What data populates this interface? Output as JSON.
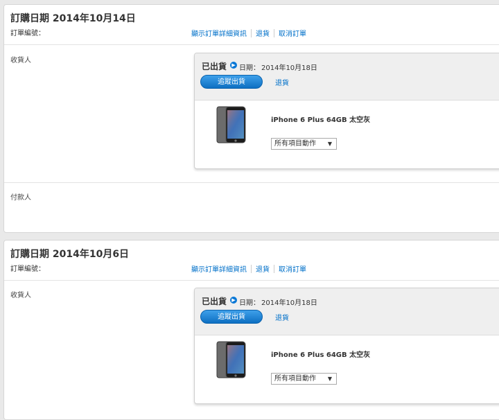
{
  "orders": [
    {
      "title": "訂購日期 2014年10月14日",
      "order_number_label": "訂單編號：",
      "links": {
        "details": "顯示訂單詳細資訊",
        "return": "退貨",
        "cancel": "取消訂單"
      },
      "recipient_label": "收貨人",
      "payer_label": "付款人",
      "shipment": {
        "status": "已出貨",
        "date_label": "日期：",
        "date_value": "2014年10月18日",
        "track_button": "追蹤出貨",
        "return_link": "退貨",
        "product_name": "iPhone 6 Plus 64GB 太空灰",
        "action_select": "所有項目動作"
      }
    },
    {
      "title": "訂購日期 2014年10月6日",
      "order_number_label": "訂單編號：",
      "links": {
        "details": "顯示訂單詳細資訊",
        "return": "退貨",
        "cancel": "取消訂單"
      },
      "recipient_label": "收貨人",
      "shipment": {
        "status": "已出貨",
        "date_label": "日期：",
        "date_value": "2014年10月18日",
        "track_button": "追蹤出貨",
        "return_link": "退貨",
        "product_name": "iPhone 6 Plus 64GB 太空灰",
        "action_select": "所有項目動作"
      }
    }
  ],
  "icons": {
    "info": "info-circle-icon",
    "dropdown": "triangle-down-icon",
    "product": "iphone-image"
  },
  "colors": {
    "link": "#0070c9",
    "button": "#1a82d8",
    "background": "#e9e9e9"
  }
}
